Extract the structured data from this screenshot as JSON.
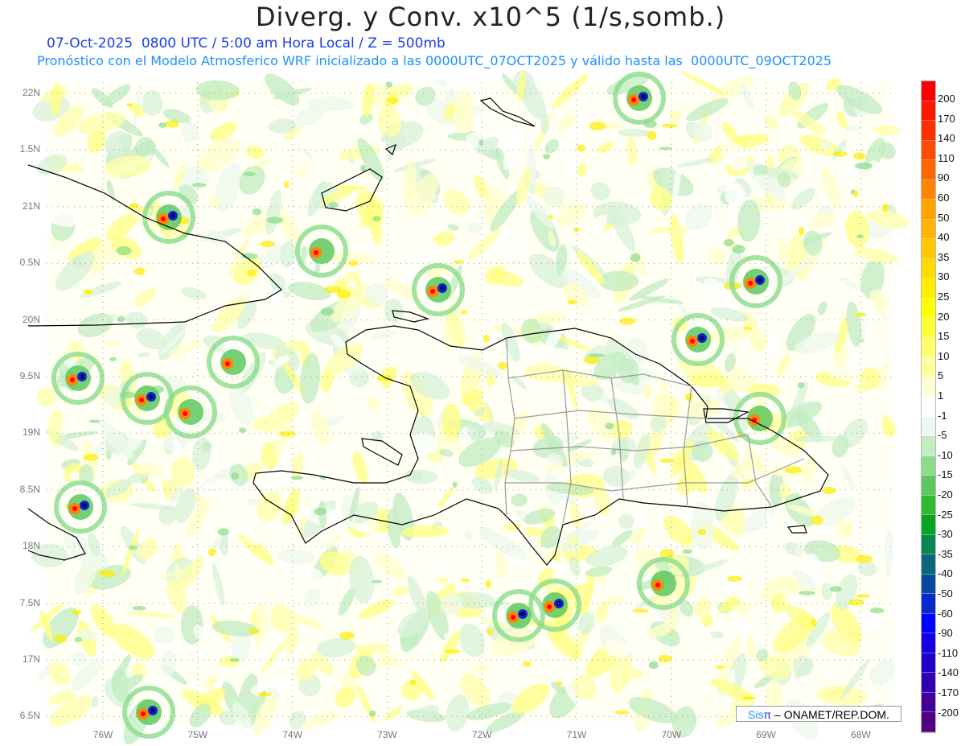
{
  "title": "Diverg. y Conv. x10^5 (1/s,somb.)",
  "subtitle_1": "07-Oct-2025  0800 UTC / 5:00 am Hora Local / Z = 500mb",
  "subtitle_2": "Pronóstico con el Modelo Atmosferico WRF inicializado a las 0000UTC_07OCT2025 y válido hasta las  0000UTC_09OCT2025",
  "lat_labels": [
    "22N",
    "1.5N",
    "21N",
    "0.5N",
    "20N",
    "9.5N",
    "19N",
    "8.5N",
    "18N",
    "7.5N",
    "17N",
    "6.5N"
  ],
  "lon_labels": [
    "76W",
    "75W",
    "74W",
    "73W",
    "72W",
    "71W",
    "70W",
    "69W",
    "68W"
  ],
  "colorbar": {
    "labels": [
      "200",
      "170",
      "140",
      "110",
      "90",
      "60",
      "50",
      "40",
      "35",
      "30",
      "25",
      "20",
      "15",
      "10",
      "5",
      "1",
      "-1",
      "-5",
      "-10",
      "-15",
      "-20",
      "-25",
      "-30",
      "-35",
      "-40",
      "-50",
      "-60",
      "-90",
      "-110",
      "-140",
      "-170",
      "-200"
    ],
    "colors": [
      "#ff0000",
      "#ff1800",
      "#ff3000",
      "#ff4c00",
      "#ff6600",
      "#ff8400",
      "#ffa200",
      "#ffb400",
      "#ffc800",
      "#ffdc00",
      "#ffee00",
      "#ffff00",
      "#ffff38",
      "#ffff70",
      "#ffffa0",
      "#ffffd8",
      "#ffffff",
      "#eef8ee",
      "#c2ecc2",
      "#8cdc8c",
      "#5ec85e",
      "#30b830",
      "#08a424",
      "#088850",
      "#08687a",
      "#0848a0",
      "#0828d0",
      "#0000ff",
      "#1000e0",
      "#2000c8",
      "#3000b0",
      "#400098",
      "#500080"
    ]
  },
  "credit": {
    "sis": "Sis",
    "pi": "π",
    "rest": " – ONAMET/REP.DOM."
  }
}
